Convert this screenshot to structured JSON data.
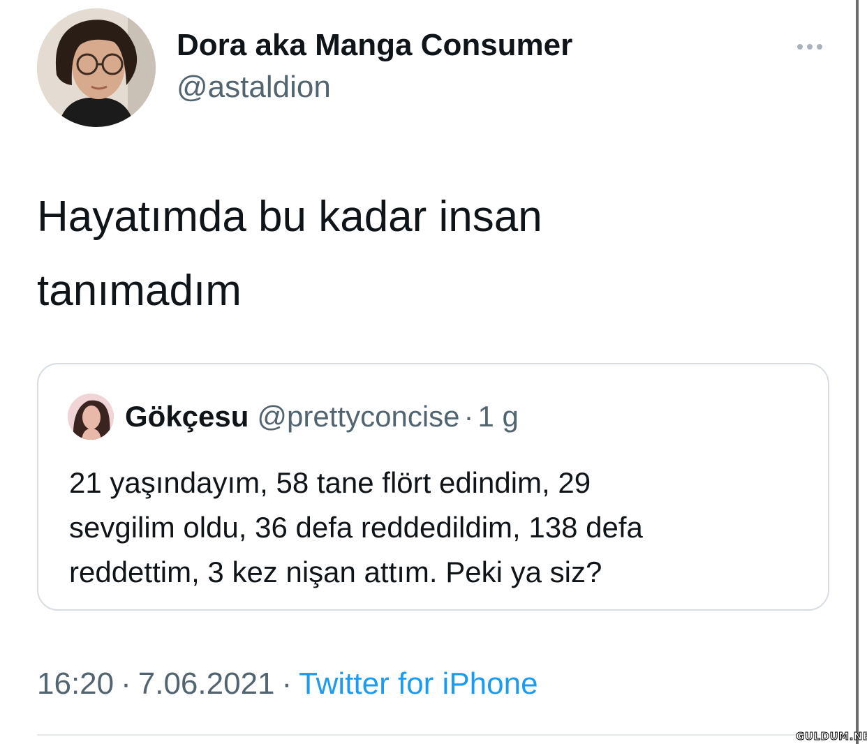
{
  "author": {
    "display_name": "Dora aka Manga Consumer",
    "handle": "@astaldion",
    "avatar_icon": "person-avatar-icon"
  },
  "more_icon": "more-options-icon",
  "tweet": {
    "text_lines": [
      "Hayatımda bu kadar insan",
      "tanımadım"
    ]
  },
  "quoted_tweet": {
    "display_name": "Gökçesu",
    "handle": "@prettyconcise",
    "separator": "·",
    "time": "1 g",
    "text_lines": [
      "21 yaşındayım, 58 tane flört edindim, 29",
      "sevgilim oldu, 36 defa reddedildim, 138 defa",
      "reddettim, 3 kez nişan attım. Peki ya siz?"
    ]
  },
  "meta": {
    "time": "16:20",
    "date": "7.06.2021",
    "separator": "·",
    "source": "Twitter for iPhone"
  },
  "watermark": "GULDUM.NET",
  "colors": {
    "text": "#0f1419",
    "secondary": "#536471",
    "link": "#1d9bf0",
    "border": "#d7dde2"
  }
}
